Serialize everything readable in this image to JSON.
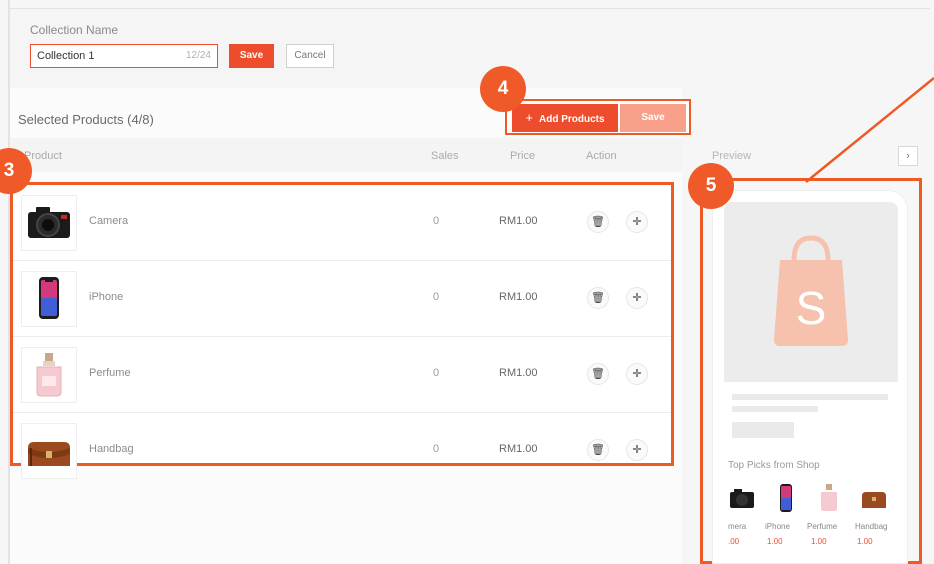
{
  "collection": {
    "name_label": "Collection Name",
    "name_value": "Collection 1",
    "name_counter": "12/24",
    "save_label": "Save",
    "cancel_label": "Cancel"
  },
  "products_section": {
    "title": "Selected Products (4/8)",
    "add_label": "Add Products",
    "save_label": "Save",
    "columns": {
      "product": "Product",
      "sales": "Sales",
      "price": "Price",
      "action": "Action"
    },
    "rows": [
      {
        "name": "Camera",
        "sales": "0",
        "price": "RM1.00",
        "image": "camera-icon"
      },
      {
        "name": "iPhone",
        "sales": "0",
        "price": "RM1.00",
        "image": "iphone-icon"
      },
      {
        "name": "Perfume",
        "sales": "0",
        "price": "RM1.00",
        "image": "perfume-icon"
      },
      {
        "name": "Handbag",
        "sales": "0",
        "price": "RM1.00",
        "image": "handbag-icon"
      }
    ]
  },
  "preview": {
    "label": "Preview",
    "top_picks": "Top Picks from Shop",
    "items": [
      {
        "name": "mera",
        "price": ".00"
      },
      {
        "name": "iPhone",
        "price": "1.00"
      },
      {
        "name": "Perfume",
        "price": "1.00"
      },
      {
        "name": "Handbag",
        "price": "1.00"
      }
    ]
  },
  "callouts": {
    "three": "3",
    "four": "4",
    "five": "5"
  },
  "colors": {
    "accent": "#ee4d2d",
    "callout": "#f05a28",
    "save_light": "#f8a08a"
  }
}
